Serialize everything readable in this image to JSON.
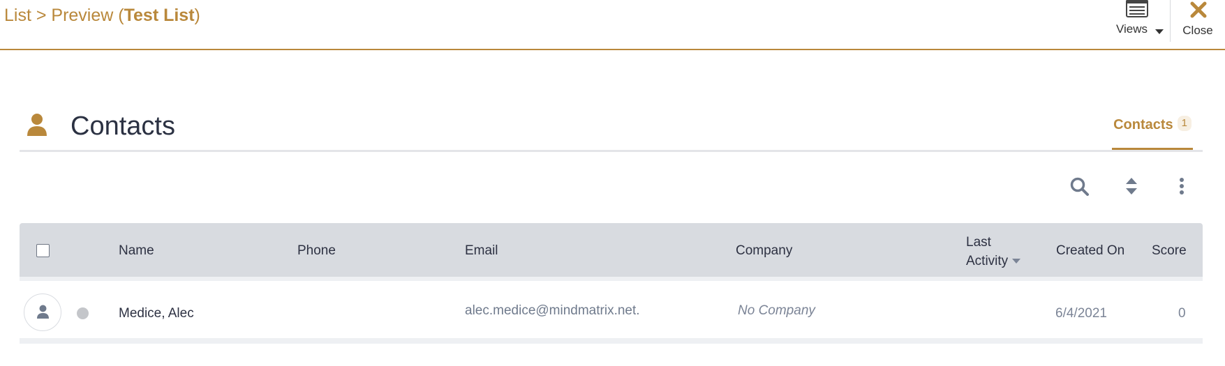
{
  "header": {
    "breadcrumb_prefix": "List > Preview (",
    "breadcrumb_name": "Test List",
    "breadcrumb_suffix": ")",
    "views_label": "Views",
    "close_label": "Close",
    "accent_color": "#b9883b"
  },
  "section": {
    "title": "Contacts",
    "icon": "person-icon"
  },
  "tabs": [
    {
      "label": "Contacts",
      "count": "1",
      "active": true
    }
  ],
  "toolbar": {
    "icons": [
      "search-icon",
      "sort-icon",
      "more-vertical-icon"
    ]
  },
  "table": {
    "columns": {
      "name": "Name",
      "phone": "Phone",
      "email": "Email",
      "company": "Company",
      "last_activity_line1": "Last",
      "last_activity_line2": "Activity",
      "created_on": "Created On",
      "score": "Score"
    },
    "rows": [
      {
        "name": "Medice, Alec",
        "phone": "",
        "email": "alec.medice@mindmatrix.net.",
        "company": "No Company",
        "last_activity": "",
        "created_on": "6/4/2021",
        "score": "0"
      }
    ]
  }
}
